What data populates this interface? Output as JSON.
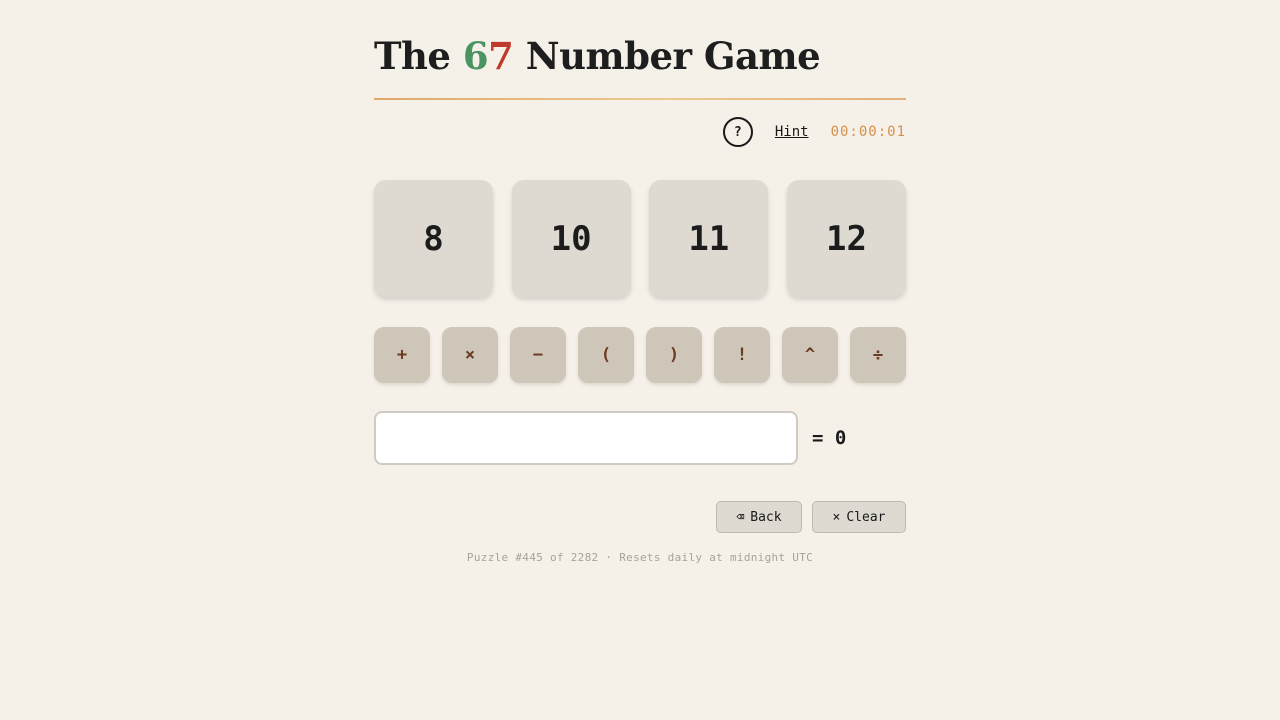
{
  "title": {
    "prefix": "The",
    "num_a": "6",
    "num_b": "7",
    "suffix": "Number Game"
  },
  "colors": {
    "six": "#4a9462",
    "seven": "#c0392b",
    "timer": "#d4914a",
    "operator_text": "#6b3a1f"
  },
  "toolbar": {
    "help_label": "?",
    "hint_label": "Hint",
    "timer": "00:00:01"
  },
  "tiles": [
    "8",
    "10",
    "11",
    "12"
  ],
  "operators": [
    "+",
    "×",
    "−",
    "(",
    ")",
    "!",
    "^",
    "÷"
  ],
  "expression": {
    "value": "",
    "placeholder": "",
    "result": "= 0"
  },
  "actions": {
    "back_icon": "⌫",
    "back_label": "Back",
    "clear_icon": "×",
    "clear_label": "Clear"
  },
  "footer": "Puzzle #445 of 2282 · Resets daily at midnight UTC"
}
